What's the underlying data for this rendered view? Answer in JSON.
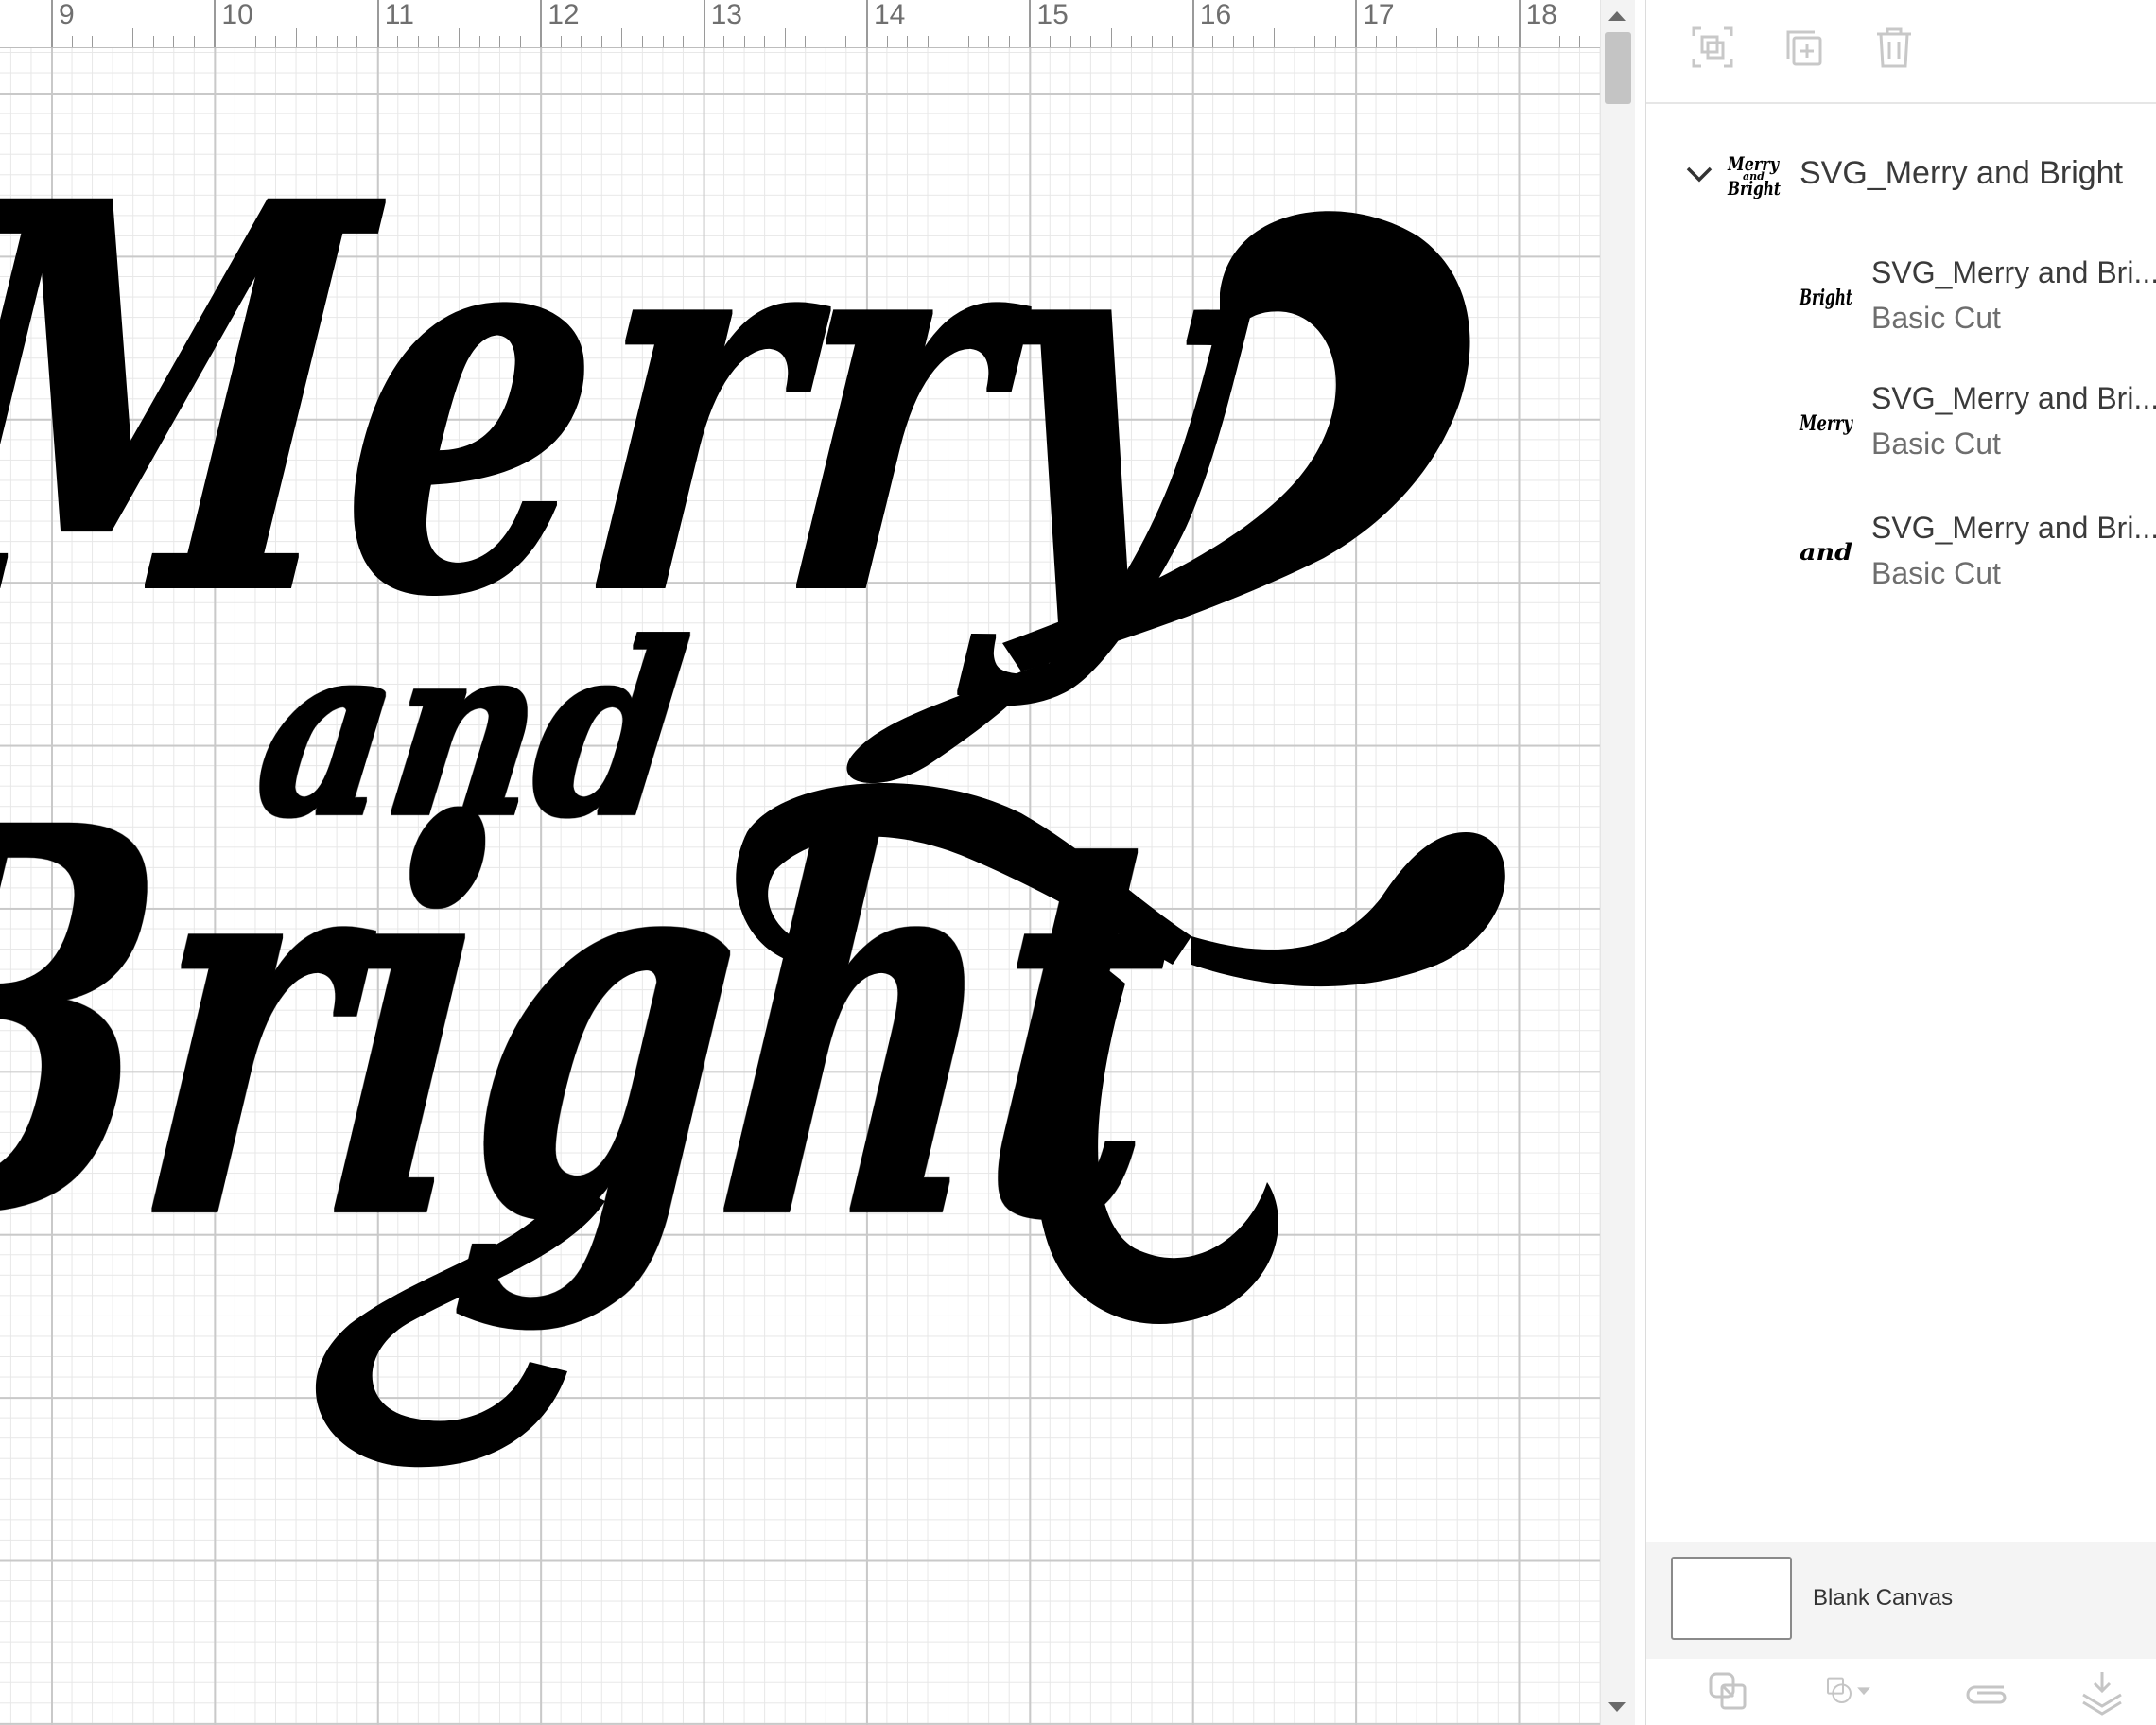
{
  "ruler": {
    "labels": [
      "9",
      "10",
      "11",
      "12",
      "13",
      "14",
      "15",
      "16",
      "17",
      "18"
    ]
  },
  "artwork": {
    "line1": "Merry",
    "line2": "and",
    "line3": "Bright"
  },
  "layers": {
    "group": {
      "name": "SVG_Merry and Bright",
      "expanded": true
    },
    "items": [
      {
        "name": "SVG_Merry and Bri...",
        "operation": "Basic Cut",
        "thumb": "Bright"
      },
      {
        "name": "SVG_Merry and Bri...",
        "operation": "Basic Cut",
        "thumb": "Merry"
      },
      {
        "name": "SVG_Merry and Bri...",
        "operation": "Basic Cut",
        "thumb": "and"
      }
    ]
  },
  "canvas": {
    "label": "Blank Canvas"
  },
  "toolbar": {
    "top_icons": [
      "group-icon",
      "duplicate-icon",
      "delete-icon"
    ],
    "bottom_icons": [
      "slice-icon",
      "combine-icon",
      "attach-icon",
      "flatten-icon"
    ]
  },
  "colors": {
    "ink": "#000000",
    "grid_major": "#c9c9c9",
    "grid_minor": "#e7e7e7",
    "icon_disabled": "#c5c5c5",
    "icon_active": "#8a8a8a"
  }
}
